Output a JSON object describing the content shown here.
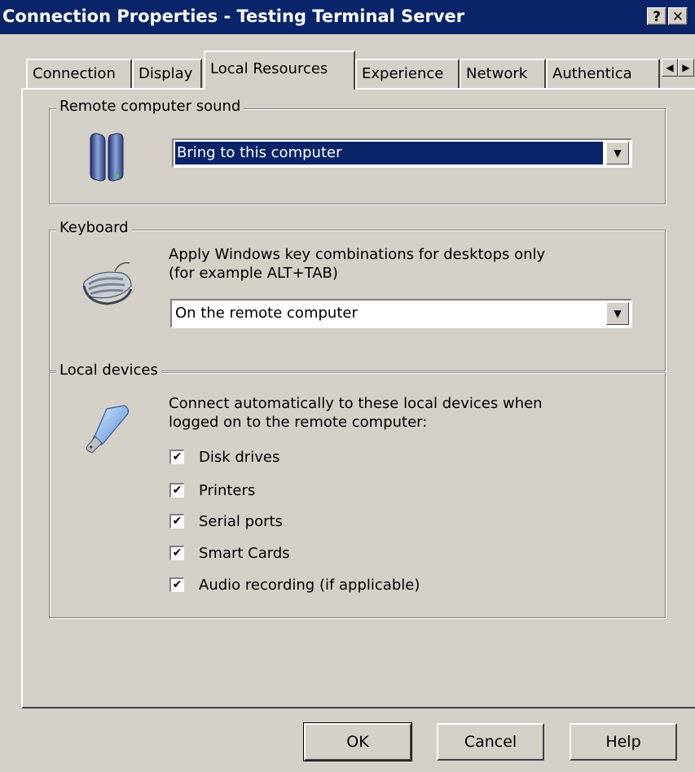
{
  "window": {
    "title": "Connection Properties - Testing Terminal Server",
    "help_label": "?",
    "close_label": "✕"
  },
  "tabs": [
    {
      "label": "Connection"
    },
    {
      "label": "Display"
    },
    {
      "label": "Local Resources"
    },
    {
      "label": "Experience"
    },
    {
      "label": "Network"
    },
    {
      "label": "Authentica"
    }
  ],
  "active_tab": "Local Resources",
  "tab_scroll": {
    "left_icon": "arrow-left-icon",
    "right_icon": "arrow-right-icon"
  },
  "sound_group": {
    "legend": "Remote computer sound",
    "icon": "speakers-icon",
    "combo_value": "Bring to this computer"
  },
  "keyboard_group": {
    "legend": "Keyboard",
    "icon": "keyboard-icon",
    "description_line1": "Apply Windows key combinations for desktops only",
    "description_line2": "(for example ALT+TAB)",
    "combo_value": "On the remote computer"
  },
  "devices_group": {
    "legend": "Local devices",
    "icon": "usb-drive-icon",
    "description_line1": "Connect automatically to these local devices when",
    "description_line2": "logged on to the remote computer:",
    "items": [
      {
        "label": "Disk drives",
        "checked": true
      },
      {
        "label": "Printers",
        "checked": true
      },
      {
        "label": "Serial ports",
        "checked": true
      },
      {
        "label": "Smart Cards",
        "checked": true
      },
      {
        "label": "Audio recording (if applicable)",
        "checked": true
      }
    ]
  },
  "buttons": {
    "ok": "OK",
    "cancel": "Cancel",
    "help": "Help"
  },
  "colors": {
    "titlebar": "#0a246a",
    "face": "#d4d0c8",
    "selection": "#0a246a"
  }
}
